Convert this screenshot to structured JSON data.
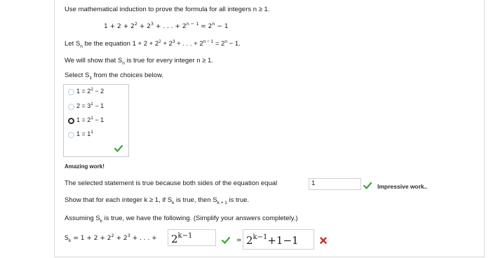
{
  "question": {
    "prompt": "Use mathematical induction to prove the formula for all integers n ≥ 1.",
    "formula": {
      "lhs_parts": [
        "1 + 2 + 2",
        "2",
        " + 2",
        "3",
        " + . . . + 2",
        "n − 1"
      ],
      "equals": " = 2",
      "rhs_exp": "n",
      "rhs_tail": " − 1"
    },
    "let_line": {
      "pre": "Let S",
      "sub": "n",
      "mid": " be the equation 1 + 2 + 2",
      "e2": "2",
      "p3": " + 2",
      "e3": "3",
      "dots": " + . . . + 2",
      "en1": "n − 1",
      "eq": " = 2",
      "en": "n",
      "tail": " − 1."
    },
    "show_line": {
      "pre": "We will show that S",
      "sub": "n",
      "post": " is true for every integer n ≥ 1."
    },
    "select_line": {
      "pre": "Select S",
      "sub": "1",
      "post": " from the choices below."
    }
  },
  "choices": [
    {
      "lhs": "1 = 2",
      "exp": "1",
      "tail": " − 2",
      "selected": false
    },
    {
      "lhs": "2 = 3",
      "exp": "1",
      "tail": " − 1",
      "selected": false
    },
    {
      "lhs": "1 = 2",
      "exp": "1",
      "tail": " − 1",
      "selected": true
    },
    {
      "lhs": "1 = 1",
      "exp": "1",
      "tail": "",
      "selected": false
    }
  ],
  "feedback": {
    "amazing": "Amazing work!",
    "impressive": "Impressive work.."
  },
  "step2": {
    "statement": "The selected statement is true because both sides of the equation equal",
    "answer": "1",
    "show_pre": "Show that for each integer k ≥ 1, if S",
    "show_sub": "k",
    "show_mid": " is true, then S",
    "show_sub2": "k + 1",
    "show_post": " is true.",
    "assume_pre": "Assuming S",
    "assume_sub": "k",
    "assume_post": " is true, we have the following. (Simplify your answers completely.)"
  },
  "equation": {
    "s_pre": "S",
    "s_sub": "k",
    "lhs_a": " = 1 + 2 + 2",
    "lhs_e2": "2",
    "lhs_b": " + 2",
    "lhs_e3": "3",
    "lhs_c": " + . . . +",
    "box1_base": "2",
    "box1_exp": "k−1",
    "equals": "=",
    "box2_base": "2",
    "box2_exp": "k−1",
    "box2_tail": "+1−1"
  },
  "colors": {
    "check": "#3aa63a",
    "wrong": "#d12b2b"
  }
}
